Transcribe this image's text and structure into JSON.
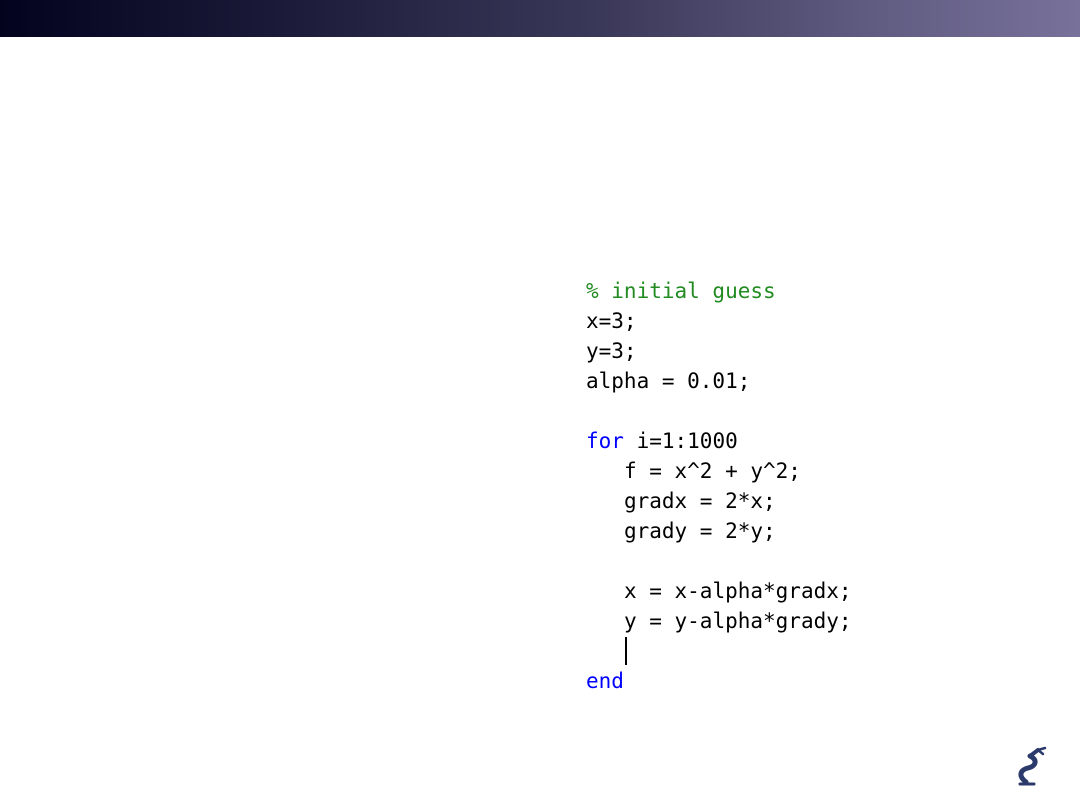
{
  "slide": {
    "header_bar": {
      "gradient_start": "#03031e",
      "gradient_end": "#78729a"
    },
    "logo": {
      "icon": "robot-arm-logo-icon",
      "color": "#2b3a6b"
    }
  },
  "code": {
    "colors": {
      "comment": "#228b22",
      "keyword": "#0000ff",
      "text": "#000000"
    },
    "lines": [
      {
        "indent": "",
        "tokens": [
          {
            "type": "comment",
            "text": "% initial guess"
          }
        ]
      },
      {
        "indent": "",
        "tokens": [
          {
            "type": "plain",
            "text": "x=3;"
          }
        ]
      },
      {
        "indent": "",
        "tokens": [
          {
            "type": "plain",
            "text": "y=3;"
          }
        ]
      },
      {
        "indent": "",
        "tokens": [
          {
            "type": "plain",
            "text": "alpha = 0.01;"
          }
        ]
      },
      {
        "indent": "",
        "tokens": []
      },
      {
        "indent": "",
        "tokens": [
          {
            "type": "keyword",
            "text": "for"
          },
          {
            "type": "plain",
            "text": " i=1:1000"
          }
        ]
      },
      {
        "indent": "   ",
        "tokens": [
          {
            "type": "plain",
            "text": "f = x^2 + y^2;"
          }
        ]
      },
      {
        "indent": "   ",
        "tokens": [
          {
            "type": "plain",
            "text": "gradx = 2*x;"
          }
        ]
      },
      {
        "indent": "   ",
        "tokens": [
          {
            "type": "plain",
            "text": "grady = 2*y;"
          }
        ]
      },
      {
        "indent": "",
        "tokens": []
      },
      {
        "indent": "   ",
        "tokens": [
          {
            "type": "plain",
            "text": "x = x-alpha*gradx;"
          }
        ]
      },
      {
        "indent": "   ",
        "tokens": [
          {
            "type": "plain",
            "text": "y = y-alpha*grady;"
          }
        ]
      },
      {
        "indent": "   ",
        "tokens": [],
        "caret": true
      },
      {
        "indent": "",
        "tokens": [
          {
            "type": "keyword",
            "text": "end"
          }
        ]
      }
    ]
  }
}
